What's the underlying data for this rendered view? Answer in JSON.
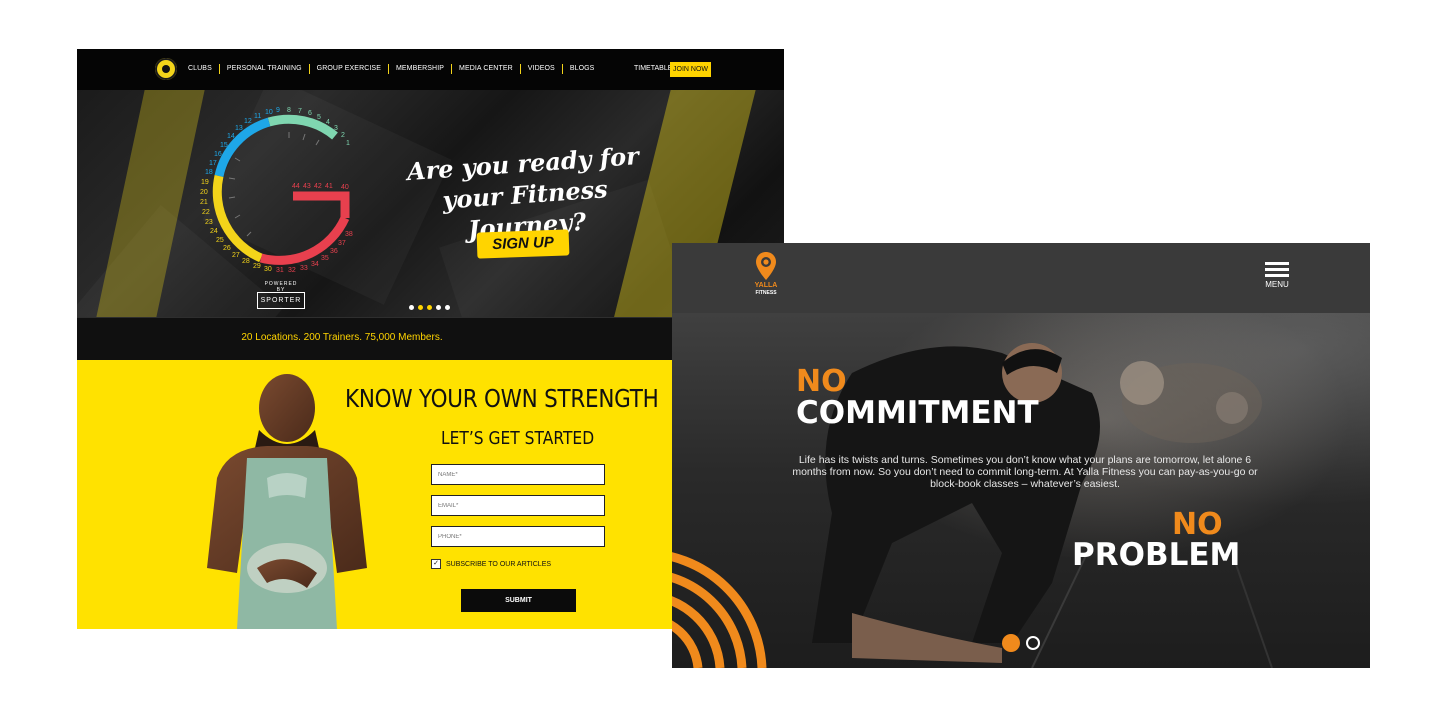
{
  "golds": {
    "nav": {
      "logo_icon": "golds-gym-logo-icon",
      "items": [
        "CLUBS",
        "PERSONAL TRAINING",
        "GROUP EXERCISE",
        "MEMBERSHIP",
        "MEDIA CENTER",
        "VIDEOS",
        "BLOGS"
      ],
      "timetable": "TIMETABLE",
      "join": "JOIN NOW",
      "accent": "#ffd400"
    },
    "hero": {
      "tagline": "Are you ready for your Fitness Journey?",
      "signup": "SIGN UP",
      "powered_by": "POWERED BY",
      "sporter": "SPORTER",
      "slide_count": 5,
      "active_slide": 2,
      "gauge_numbers_top": [
        "15",
        "14",
        "13",
        "12",
        "11",
        "10",
        "9",
        "8",
        "7",
        "6",
        "5",
        "4",
        "3",
        "2",
        "1"
      ],
      "gauge_numbers_inner": [
        "44",
        "43",
        "42",
        "41",
        "40"
      ],
      "gauge_numbers_left": [
        "18",
        "17",
        "16",
        "19",
        "20",
        "21",
        "22",
        "23",
        "24",
        "25",
        "26",
        "27",
        "28",
        "29",
        "30",
        "31",
        "32",
        "33",
        "34",
        "35",
        "36",
        "37",
        "38"
      ],
      "gauge_colors": [
        "#7fd6b0",
        "#1ea7e8",
        "#f3d41a",
        "#e8404e"
      ]
    },
    "stats": "20 Locations. 200 Trainers. 75,000 Members.",
    "form": {
      "title": "KNOW YOUR OWN STRENGTH",
      "subtitle": "LET’S GET STARTED",
      "name_placeholder": "NAME*",
      "email_placeholder": "EMAIL*",
      "phone_placeholder": "PHONE*",
      "subscribe_label": "SUBSCRIBE TO OUR ARTICLES",
      "subscribe_checked": true,
      "submit": "SUBMIT",
      "background": "#ffe200"
    }
  },
  "yalla": {
    "brand": "YALLA",
    "brand_sub": "FITNESS",
    "pin_icon": "location-pin-icon",
    "menu_label": "MENU",
    "headline_1_accent": "NO",
    "headline_1": "COMMITMENT",
    "body": "Life has its twists and turns. Sometimes you don’t know what your plans are tomorrow, let alone 6 months from now. So you don’t need to commit long-term. At Yalla Fitness you can pay-as-you-go or block-book classes – whatever’s easiest.",
    "headline_2_accent": "NO",
    "headline_2": "PROBLEM",
    "accent": "#f08a1c",
    "slide_count": 2,
    "active_slide": 1
  }
}
